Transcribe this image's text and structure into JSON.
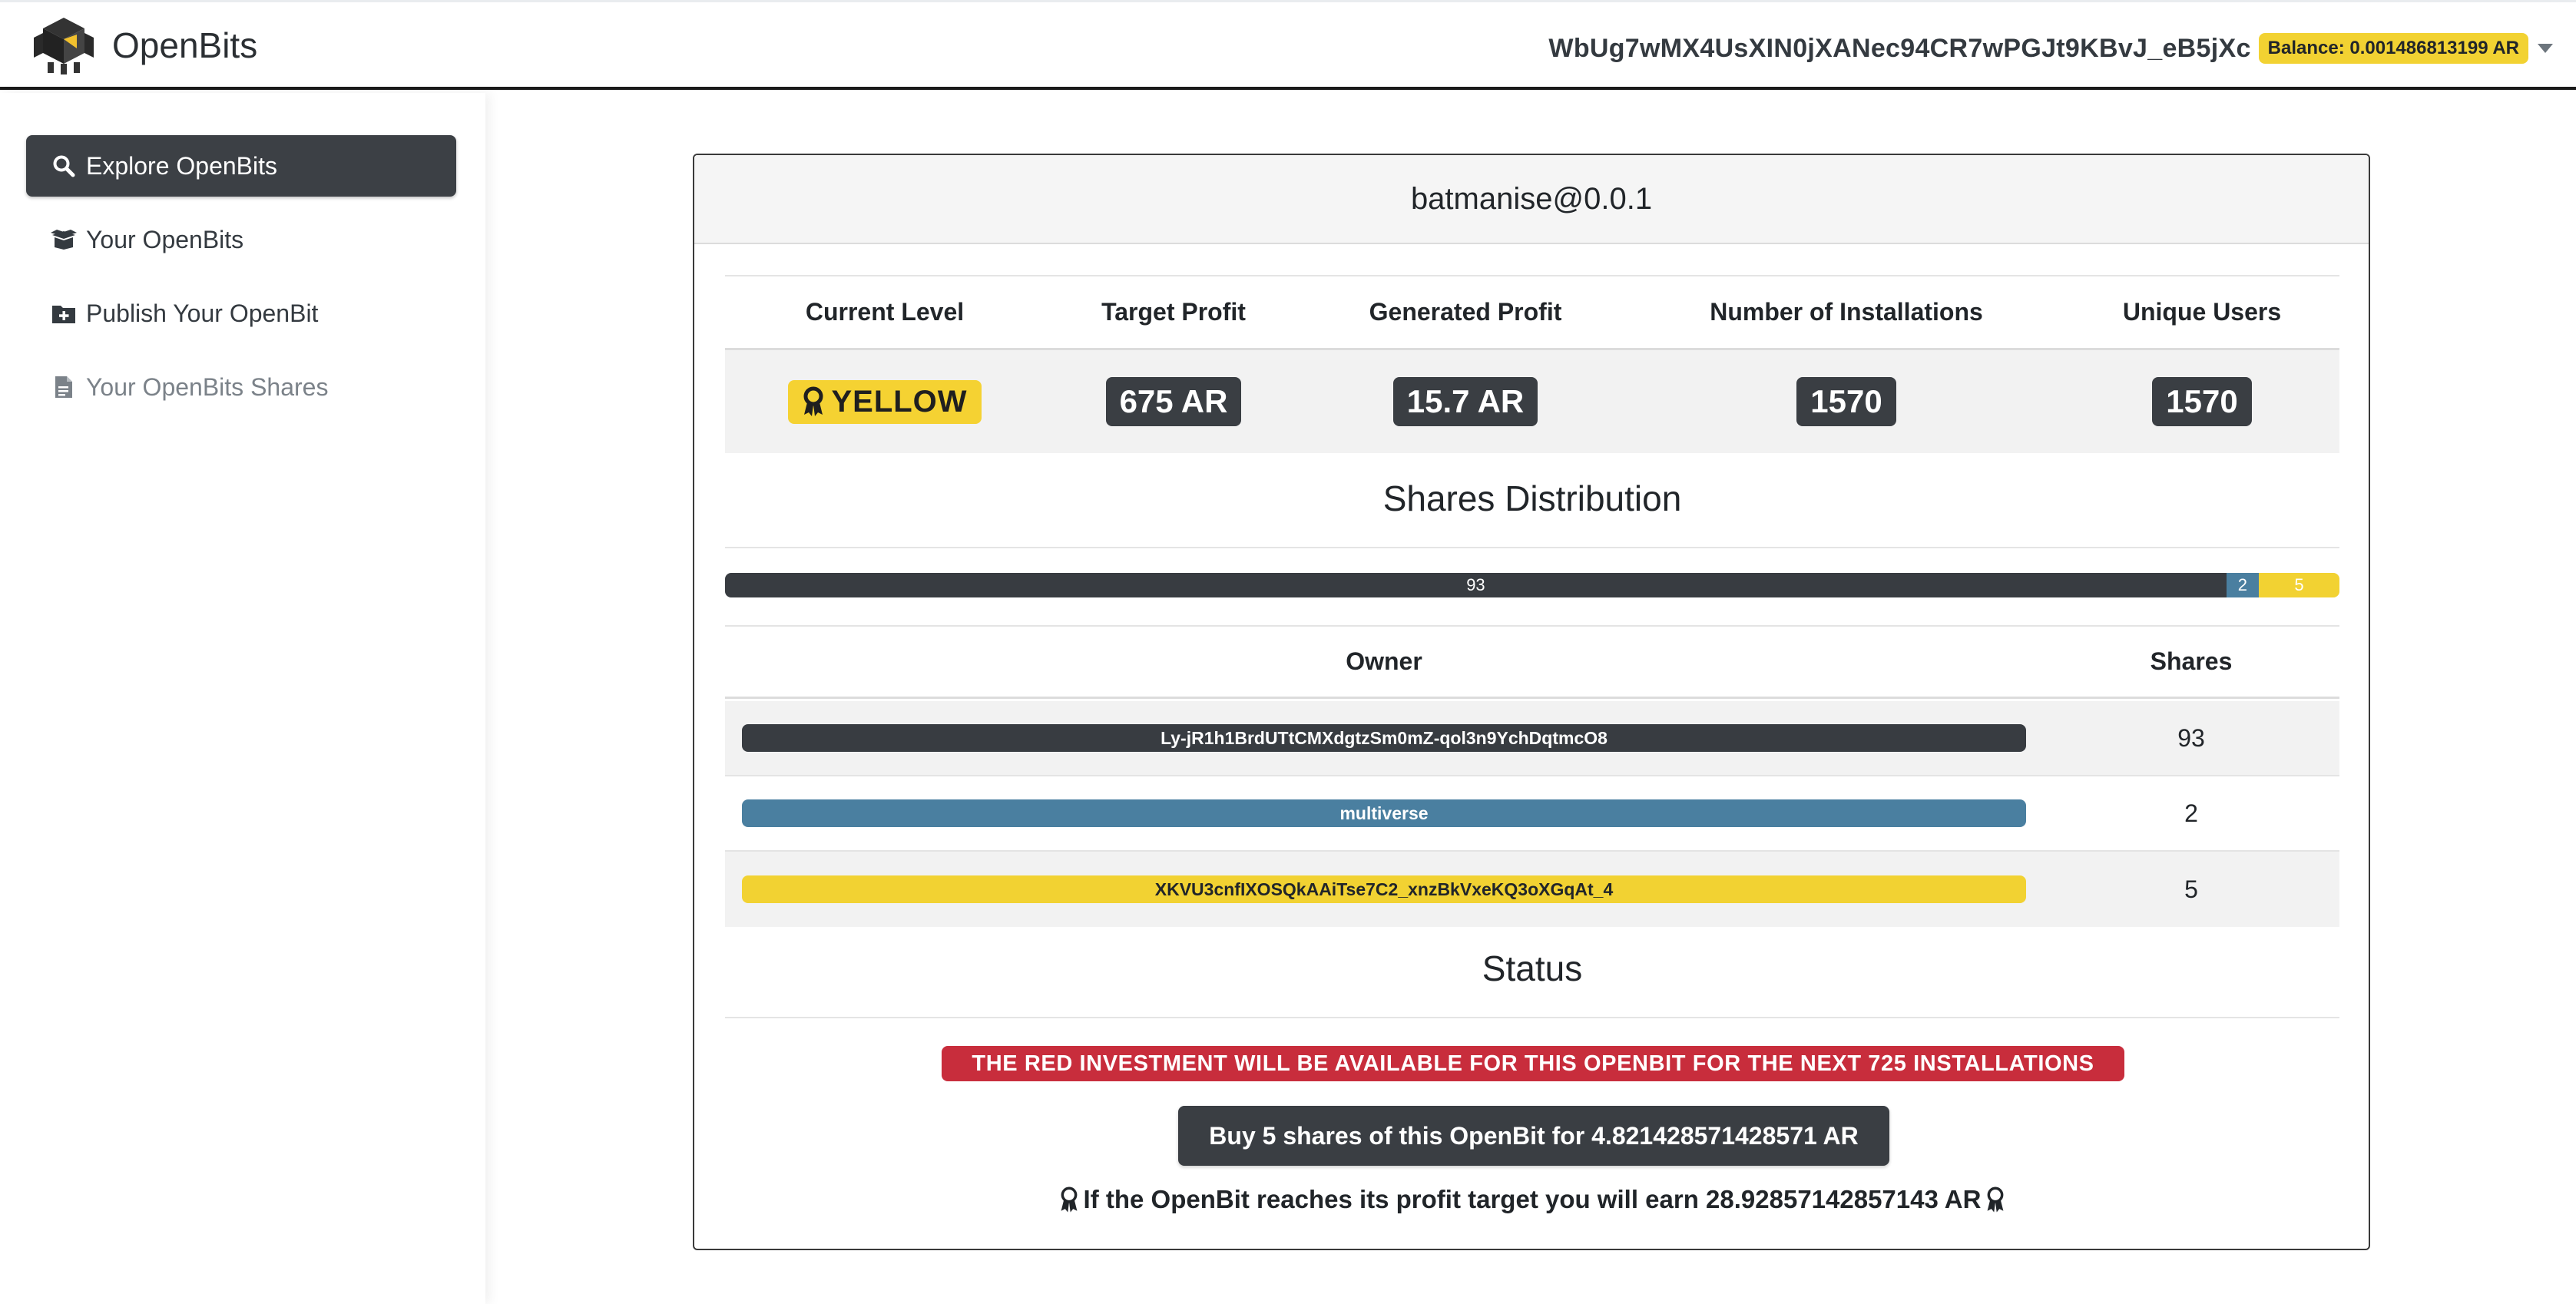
{
  "app": {
    "name": "OpenBits"
  },
  "account": {
    "address": "WbUg7wMX4UsXIN0jXANec94CR7wPGJt9KBvJ_eB5jXc",
    "balance": "Balance: 0.001486813199 AR"
  },
  "sidebar": {
    "items": [
      {
        "label": "Explore OpenBits",
        "icon": "search-icon",
        "state": "active"
      },
      {
        "label": "Your OpenBits",
        "icon": "box-open-icon",
        "state": "normal"
      },
      {
        "label": "Publish Your OpenBit",
        "icon": "folder-plus-icon",
        "state": "normal"
      },
      {
        "label": "Your OpenBits Shares",
        "icon": "file-icon",
        "state": "muted"
      }
    ]
  },
  "card": {
    "title": "batmanise@0.0.1",
    "stats": {
      "headers": [
        "Current Level",
        "Target Profit",
        "Generated Profit",
        "Number of Installations",
        "Unique Users"
      ],
      "values": {
        "level": "YELLOW",
        "target_profit": "675 AR",
        "generated_profit": "15.7 AR",
        "installations": "1570",
        "unique_users": "1570"
      }
    },
    "shares_title": "Shares Distribution",
    "distribution": [
      {
        "label": "93",
        "value": 93,
        "color": "#383c41"
      },
      {
        "label": "2",
        "value": 2,
        "color": "#4a7fa0"
      },
      {
        "label": "5",
        "value": 5,
        "color": "#f2d232"
      }
    ],
    "owners_table": {
      "headers": [
        "Owner",
        "Shares"
      ],
      "rows": [
        {
          "owner": "Ly-jR1h1BrdUTtCMXdgtzSm0mZ-qol3n9YchDqtmcO8",
          "shares": "93",
          "color": "#383c41",
          "text_color": "#ffffff"
        },
        {
          "owner": "multiverse",
          "shares": "2",
          "color": "#4a7fa0",
          "text_color": "#ffffff"
        },
        {
          "owner": "XKVU3cnfIXOSQkAAiTse7C2_xnzBkVxeKQ3oXGqAt_4",
          "shares": "5",
          "color": "#f2d232",
          "text_color": "#212529"
        }
      ]
    },
    "status_title": "Status",
    "alert": "THE RED INVESTMENT WILL BE AVAILABLE FOR THIS OPENBIT FOR THE NEXT 725 INSTALLATIONS",
    "buy_button": "Buy 5 shares of this OpenBit for 4.821428571428571 AR",
    "earn_text": "If the OpenBit reaches its profit target you will earn 28.92857142857143 AR"
  },
  "colors": {
    "dark": "#3a3e43",
    "yellow": "#f2d232",
    "blue": "#4a7fa0",
    "red": "#c82d3c"
  }
}
